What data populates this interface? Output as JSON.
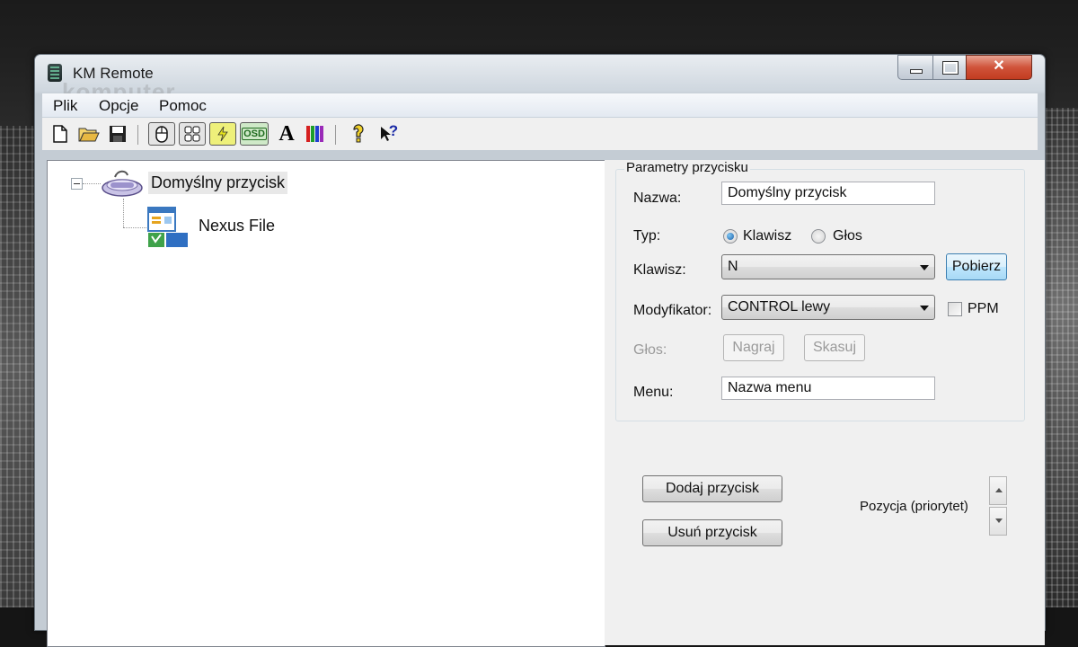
{
  "window": {
    "title": "KM Remote",
    "watermark": "komputer",
    "close_glyph": "✕"
  },
  "menu": {
    "items": [
      "Plik",
      "Opcje",
      "Pomoc"
    ]
  },
  "toolbar": {
    "icons": [
      "new-file-icon",
      "open-folder-icon",
      "save-icon",
      "mouse-icon",
      "grid-icon",
      "lightning-icon",
      "osd-icon",
      "font-icon",
      "color-bars-icon",
      "help-icon",
      "context-help-icon"
    ],
    "osd_text": "OSD",
    "font_glyph": "A",
    "help_glyph": "?"
  },
  "tree": {
    "root_label": "Domyślny przycisk",
    "child_label": "Nexus File"
  },
  "params": {
    "group_title": "Parametry przycisku",
    "name_label": "Nazwa:",
    "name_value": "Domyślny przycisk",
    "type_label": "Typ:",
    "type_option_key": "Klawisz",
    "type_option_voice": "Głos",
    "type_selected": "Klawisz",
    "key_label": "Klawisz:",
    "key_value": "N",
    "fetch_button": "Pobierz",
    "modifier_label": "Modyfikator:",
    "modifier_value": "CONTROL lewy",
    "ppm_label": "PPM",
    "voice_label": "Głos:",
    "record_button": "Nagraj",
    "delete_voice_button": "Skasuj",
    "menu_label": "Menu:",
    "menu_value": "Nazwa menu"
  },
  "actions": {
    "add_button": "Dodaj przycisk",
    "remove_button": "Usuń przycisk",
    "position_label": "Pozycja (priorytet)"
  }
}
